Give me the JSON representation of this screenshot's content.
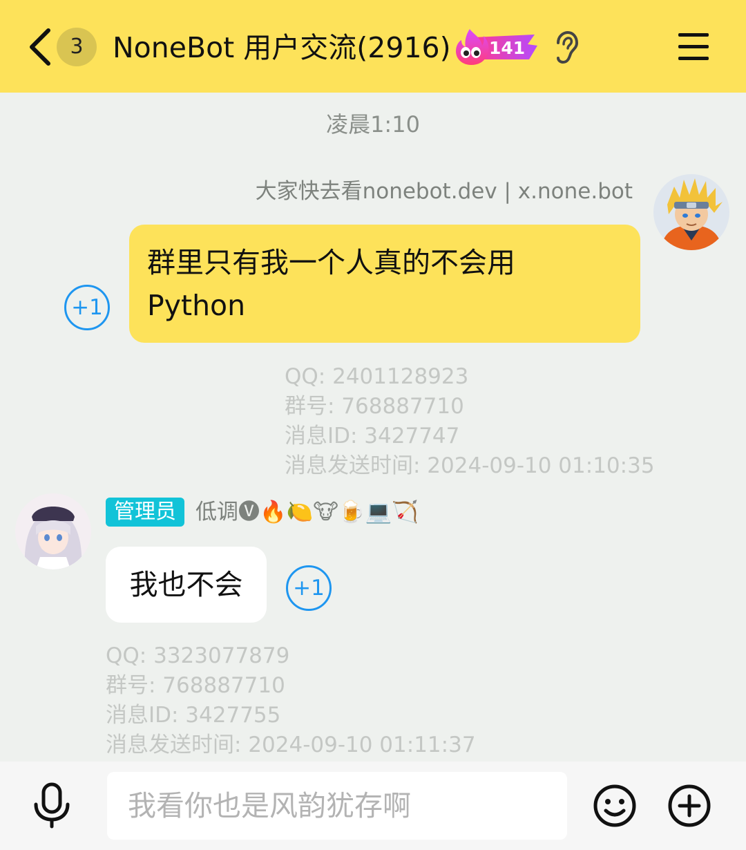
{
  "header": {
    "unread_count": "3",
    "title": "NoneBot 用户交流(2916)",
    "fire_count": "141"
  },
  "chat": {
    "time_divider": "凌晨1:10",
    "messages": [
      {
        "sender_name": "大家快去看nonebot.dev | x.none.bot",
        "text_line1": "群里只有我一个人真的不会用",
        "text_line2": "Python",
        "plus_one": "+1",
        "meta": {
          "qq": "QQ: 2401128923",
          "group": "群号: 768887710",
          "msg_id": "消息ID: 3427747",
          "sent_at": "消息发送时间: 2024-09-10 01:10:35"
        }
      },
      {
        "role_tag": "管理员",
        "sender_name": "低调🅥🔥🍋🐮🍺💻🏹",
        "text": "我也不会",
        "plus_one": "+1",
        "meta": {
          "qq": "QQ: 3323077879",
          "group": "群号: 768887710",
          "msg_id": "消息ID: 3427755",
          "sent_at": "消息发送时间: 2024-09-10 01:11:37"
        }
      }
    ]
  },
  "input": {
    "placeholder": "我看你也是风韵犹存啊"
  },
  "colors": {
    "header_bg": "#fde25a",
    "own_bubble": "#fde25a",
    "admin_tag": "#12c3d8",
    "plus_one": "#1e96f0"
  }
}
